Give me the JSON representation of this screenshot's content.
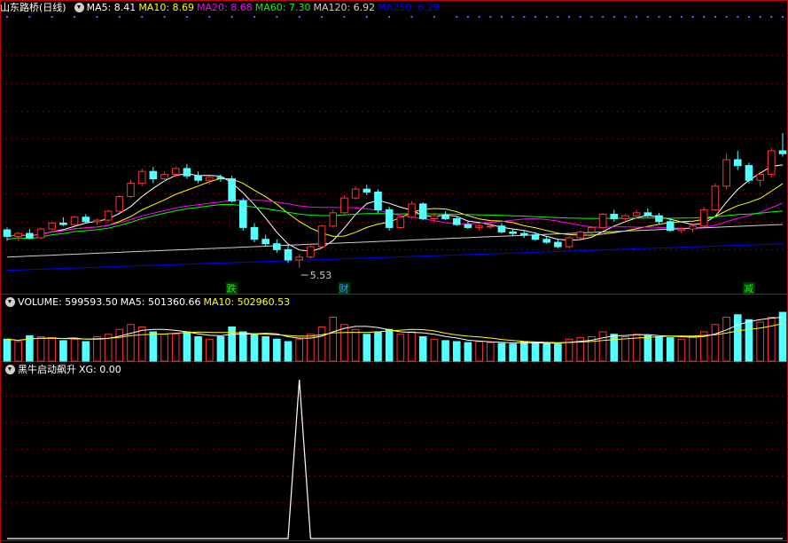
{
  "header": {
    "stock_title": "山东路桥(日线)",
    "ma": [
      {
        "label": "MA5:",
        "value": "8.41",
        "color": "#ffffff"
      },
      {
        "label": "MA10:",
        "value": "8.69",
        "color": "#ffff00"
      },
      {
        "label": "MA20:",
        "value": "8.68",
        "color": "#ff00ff"
      },
      {
        "label": "MA60:",
        "value": "7.30",
        "color": "#00ff00"
      },
      {
        "label": "MA120:",
        "value": "6.92",
        "color": "#d0d0d0"
      },
      {
        "label": "MA250:",
        "value": "6.29",
        "color": "#0000ff"
      }
    ]
  },
  "volume_header": {
    "items": [
      {
        "label": "VOLUME:",
        "value": "599593.50",
        "color": "#ffffff"
      },
      {
        "label": "MA5:",
        "value": "501360.66",
        "color": "#ffffff"
      },
      {
        "label": "MA10:",
        "value": "502960.53",
        "color": "#ffff00"
      }
    ]
  },
  "indicator_header": {
    "name": "黑牛启动飙升",
    "items": [
      {
        "label": "XG:",
        "value": "0.00",
        "color": "#ffffff"
      }
    ]
  },
  "price_panel": {
    "min_label": "5.53",
    "badges": [
      {
        "text": "跌",
        "color": "#00ff00"
      },
      {
        "text": "财",
        "color": "#3399ff"
      },
      {
        "text": "减",
        "color": "#00ff00"
      }
    ]
  },
  "chart_data": {
    "type": "candlestick",
    "bars": 70,
    "xg_peak_index": 26,
    "ohlc": [
      [
        6.82,
        6.9,
        6.45,
        6.6
      ],
      [
        6.6,
        6.75,
        6.45,
        6.7
      ],
      [
        6.7,
        6.85,
        6.5,
        6.55
      ],
      [
        6.55,
        6.9,
        6.5,
        6.85
      ],
      [
        6.85,
        7.1,
        6.8,
        7.05
      ],
      [
        7.05,
        7.25,
        6.95,
        7.0
      ],
      [
        7.0,
        7.3,
        6.95,
        7.25
      ],
      [
        7.25,
        7.35,
        7.05,
        7.1
      ],
      [
        7.1,
        7.2,
        7.0,
        7.15
      ],
      [
        7.15,
        7.5,
        7.1,
        7.45
      ],
      [
        7.45,
        8.0,
        7.4,
        7.95
      ],
      [
        7.95,
        8.5,
        7.9,
        8.4
      ],
      [
        8.4,
        8.9,
        8.3,
        8.8
      ],
      [
        8.8,
        8.95,
        8.4,
        8.55
      ],
      [
        8.55,
        8.8,
        8.45,
        8.7
      ],
      [
        8.7,
        8.95,
        8.6,
        8.9
      ],
      [
        8.9,
        9.05,
        8.55,
        8.65
      ],
      [
        8.65,
        8.8,
        8.4,
        8.5
      ],
      [
        8.5,
        8.65,
        8.35,
        8.6
      ],
      [
        8.6,
        8.7,
        8.45,
        8.55
      ],
      [
        8.55,
        8.65,
        7.75,
        7.8
      ],
      [
        7.8,
        7.9,
        6.8,
        6.9
      ],
      [
        6.9,
        7.05,
        6.4,
        6.5
      ],
      [
        6.5,
        6.65,
        6.25,
        6.35
      ],
      [
        6.35,
        6.5,
        6.05,
        6.15
      ],
      [
        6.15,
        6.3,
        5.7,
        5.8
      ],
      [
        5.8,
        6.0,
        5.53,
        5.9
      ],
      [
        5.9,
        6.3,
        5.85,
        6.25
      ],
      [
        6.25,
        7.0,
        6.2,
        6.95
      ],
      [
        6.95,
        7.5,
        6.9,
        7.4
      ],
      [
        7.4,
        8.0,
        7.35,
        7.9
      ],
      [
        7.9,
        8.3,
        7.85,
        8.2
      ],
      [
        8.2,
        8.35,
        8.0,
        8.1
      ],
      [
        8.1,
        8.2,
        7.4,
        7.5
      ],
      [
        7.5,
        7.6,
        6.8,
        6.9
      ],
      [
        6.9,
        7.3,
        6.85,
        7.25
      ],
      [
        7.25,
        7.8,
        7.2,
        7.7
      ],
      [
        7.7,
        7.75,
        7.15,
        7.2
      ],
      [
        7.2,
        7.4,
        7.05,
        7.3
      ],
      [
        7.3,
        7.45,
        7.15,
        7.2
      ],
      [
        7.2,
        7.3,
        6.95,
        7.0
      ],
      [
        7.0,
        7.1,
        6.85,
        6.9
      ],
      [
        6.9,
        7.05,
        6.8,
        6.95
      ],
      [
        6.95,
        7.1,
        6.85,
        6.95
      ],
      [
        6.95,
        7.05,
        6.7,
        6.75
      ],
      [
        6.75,
        6.85,
        6.6,
        6.7
      ],
      [
        6.7,
        6.8,
        6.55,
        6.65
      ],
      [
        6.65,
        6.75,
        6.45,
        6.5
      ],
      [
        6.5,
        6.6,
        6.35,
        6.4
      ],
      [
        6.4,
        6.5,
        6.2,
        6.25
      ],
      [
        6.25,
        6.6,
        6.2,
        6.55
      ],
      [
        6.55,
        6.8,
        6.5,
        6.75
      ],
      [
        6.75,
        6.95,
        6.65,
        6.9
      ],
      [
        6.9,
        7.4,
        6.85,
        7.35
      ],
      [
        7.35,
        7.5,
        7.1,
        7.2
      ],
      [
        7.2,
        7.35,
        7.05,
        7.3
      ],
      [
        7.3,
        7.5,
        7.2,
        7.4
      ],
      [
        7.4,
        7.55,
        7.25,
        7.3
      ],
      [
        7.3,
        7.4,
        7.0,
        7.1
      ],
      [
        7.1,
        7.2,
        6.75,
        6.8
      ],
      [
        6.8,
        6.9,
        6.7,
        6.85
      ],
      [
        6.85,
        7.0,
        6.75,
        6.95
      ],
      [
        6.95,
        7.6,
        6.9,
        7.5
      ],
      [
        7.5,
        8.4,
        7.45,
        8.3
      ],
      [
        8.3,
        9.4,
        8.2,
        9.2
      ],
      [
        9.2,
        9.5,
        8.85,
        9.0
      ],
      [
        9.0,
        9.1,
        8.4,
        8.5
      ],
      [
        8.5,
        8.8,
        8.3,
        8.7
      ],
      [
        8.7,
        9.6,
        8.6,
        9.5
      ],
      [
        9.5,
        10.1,
        9.3,
        9.4
      ]
    ],
    "volume": [
      0.45,
      0.4,
      0.52,
      0.5,
      0.48,
      0.42,
      0.45,
      0.4,
      0.5,
      0.55,
      0.65,
      0.75,
      0.7,
      0.6,
      0.55,
      0.55,
      0.6,
      0.5,
      0.45,
      0.5,
      0.7,
      0.6,
      0.55,
      0.5,
      0.45,
      0.4,
      0.45,
      0.55,
      0.7,
      0.9,
      0.75,
      0.65,
      0.55,
      0.6,
      0.65,
      0.55,
      0.6,
      0.5,
      0.45,
      0.42,
      0.4,
      0.38,
      0.4,
      0.38,
      0.36,
      0.35,
      0.4,
      0.38,
      0.36,
      0.35,
      0.45,
      0.48,
      0.5,
      0.6,
      0.55,
      0.5,
      0.55,
      0.52,
      0.5,
      0.48,
      0.45,
      0.5,
      0.6,
      0.75,
      0.9,
      0.95,
      0.85,
      0.8,
      0.9,
      1.0
    ],
    "xg": {
      "peak_value": 1,
      "other_value": 0
    }
  }
}
